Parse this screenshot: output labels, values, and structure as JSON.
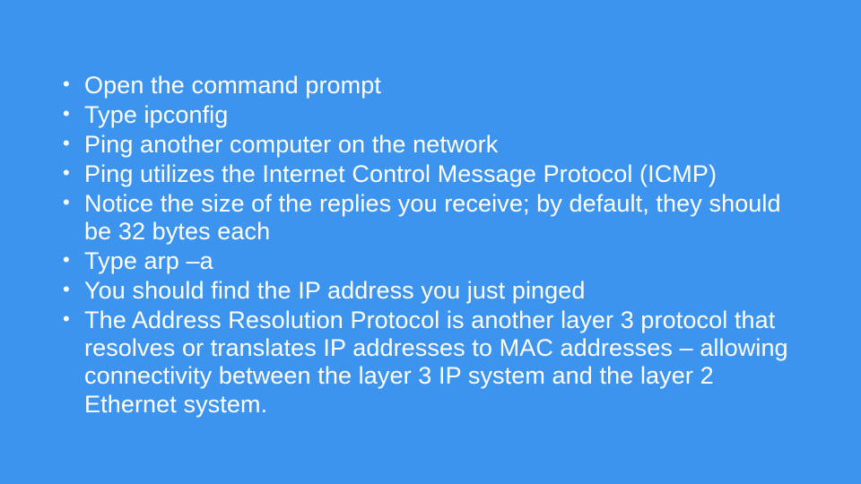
{
  "slide": {
    "bullets": [
      "Open the command prompt",
      "Type ipconfig",
      "Ping another computer on the network",
      "Ping utilizes the Internet Control Message Protocol (ICMP)",
      "Notice the size of the replies you receive; by default, they should be 32 bytes each",
      "Type arp –a",
      "You should find the IP address you just pinged",
      "The Address Resolution Protocol is another layer 3 protocol that resolves or translates IP addresses to MAC addresses – allowing connectivity between the layer 3 IP system and the layer 2 Ethernet system."
    ]
  }
}
